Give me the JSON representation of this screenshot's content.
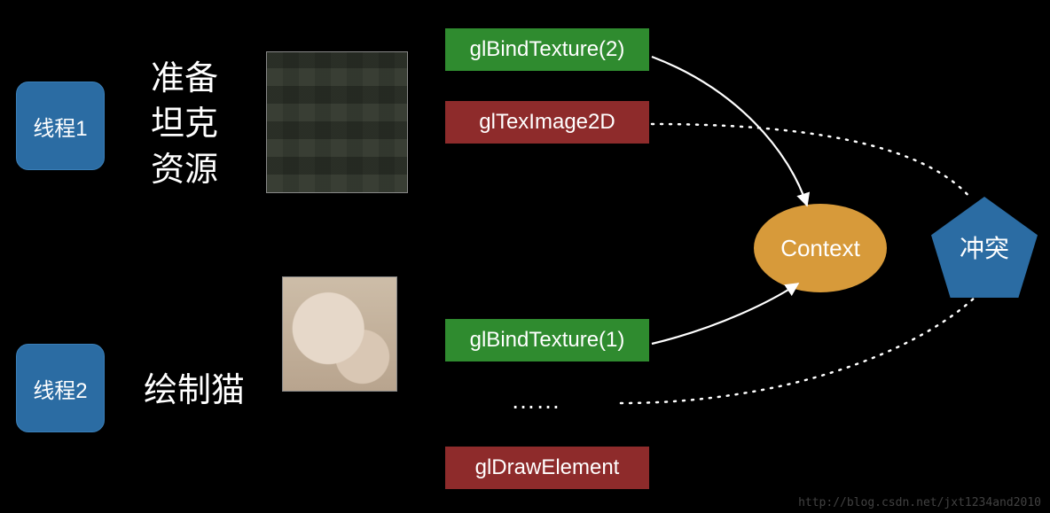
{
  "threads": {
    "t1": "线程1",
    "t2": "线程2"
  },
  "labels": {
    "prepare_tank": "准备\n坦克\n资源",
    "draw_cat": "绘制猫"
  },
  "gl_calls": {
    "bind2": "glBindTexture(2)",
    "teximage": "glTexImage2D",
    "bind1": "glBindTexture(1)",
    "ellipsis": "……",
    "draw": "glDrawElement"
  },
  "context": "Context",
  "conflict": "冲突",
  "watermark": "http://blog.csdn.net/jxt1234and2010",
  "colors": {
    "green": "#2f8b2f",
    "red": "#8e2b2b",
    "blue": "#2b6ca3",
    "orange": "#d79a3a"
  }
}
